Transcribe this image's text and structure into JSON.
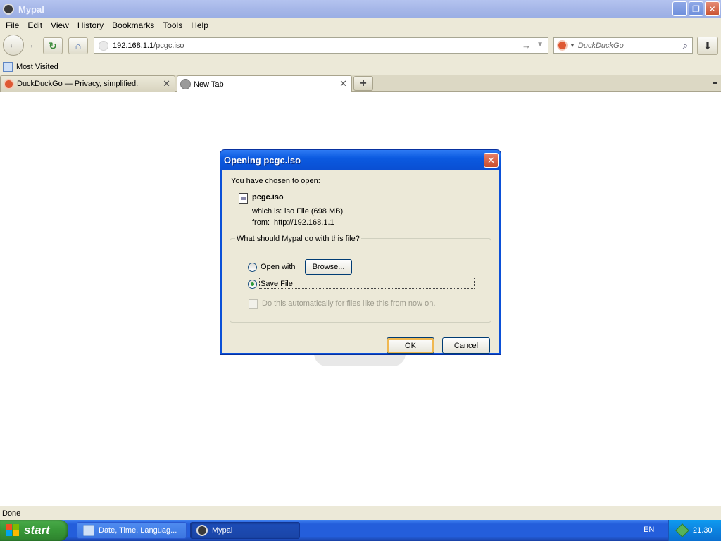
{
  "window": {
    "title": "Mypal",
    "minimize_glyph": "_",
    "restore_glyph": "❐",
    "close_glyph": "✕"
  },
  "menu": [
    "File",
    "Edit",
    "View",
    "History",
    "Bookmarks",
    "Tools",
    "Help"
  ],
  "toolbar": {
    "back_glyph": "←",
    "forward_glyph": "→",
    "reload_glyph": "↻",
    "home_glyph": "⌂",
    "go_glyph": "→",
    "download_glyph": "⬇"
  },
  "urlbar": {
    "host": "192.168.1.1",
    "path": "/pcgc.iso"
  },
  "search": {
    "engine_icon": "duckduckgo-icon",
    "placeholder": "DuckDuckGo"
  },
  "bookmarks": {
    "items": [
      {
        "label": "Most Visited",
        "icon": "bookmark-folder-icon"
      }
    ]
  },
  "tabs": [
    {
      "label": "DuckDuckGo — Privacy, simplified.",
      "icon": "duckduckgo-icon",
      "active": false
    },
    {
      "label": "New Tab",
      "icon": "globe-icon",
      "active": true
    }
  ],
  "status": {
    "text": "Done"
  },
  "dialog": {
    "title": "Opening pcgc.iso",
    "close_glyph": "✕",
    "intro": "You have chosen to open:",
    "file_name": "pcgc.iso",
    "which_is_label": "which is:",
    "which_is_value": "iso File (698 MB)",
    "from_label": "from:",
    "from_value": "http://192.168.1.1",
    "question": "What should Mypal do with this file?",
    "open_with_label": "Open with",
    "browse_label": "Browse...",
    "save_file_label": "Save File",
    "selected_option": "save_file",
    "auto_label": "Do this automatically for files like this from now on.",
    "ok_label": "OK",
    "cancel_label": "Cancel"
  },
  "taskbar": {
    "start_label": "start",
    "tasks": [
      {
        "label": "Date, Time, Languag...",
        "icon": "control-panel-icon"
      },
      {
        "label": "Mypal",
        "icon": "mypal-icon"
      }
    ],
    "language": "EN",
    "clock": "21.30"
  },
  "colors": {
    "titlebar_inactive": "#a6b7e8",
    "dialog_title": "#0b5ae0",
    "taskbar": "#245edb",
    "start": "#379737",
    "tray": "#0c83e0",
    "chrome_bg": "#ece9d8"
  }
}
